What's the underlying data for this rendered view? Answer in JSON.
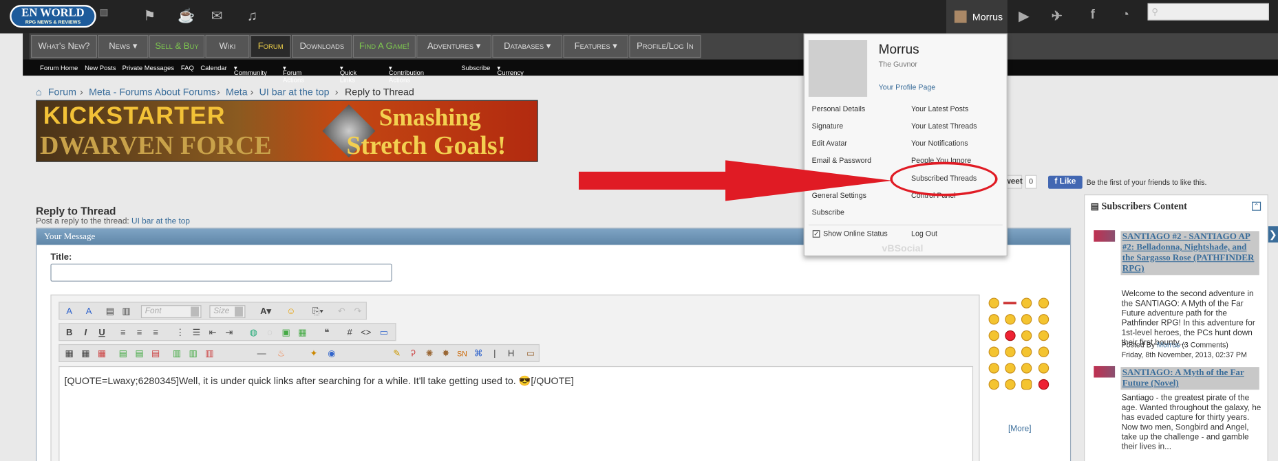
{
  "topbar": {
    "logo": "EN WORLD",
    "logo_tag": "RPG NEWS & REVIEWS",
    "icons": [
      "flag-icon",
      "cup-icon",
      "chat-icon",
      "bell-icon"
    ],
    "user": "Morrus",
    "social_icons": [
      "youtube-icon",
      "twitter-icon",
      "facebook-icon",
      "rss-icon"
    ],
    "search_placeholder": ""
  },
  "nav": {
    "items": [
      "What's New?",
      "News",
      "Sell & Buy",
      "Wiki",
      "Forum",
      "Downloads",
      "Find A Game!",
      "Adventures",
      "Databases",
      "Features",
      "Profile/Log In"
    ]
  },
  "subnav": {
    "items": [
      "Forum Home",
      "New Posts",
      "Private Messages",
      "FAQ",
      "Calendar",
      "Community",
      "Forum Actions",
      "Quick Links",
      "Contribution Actions",
      "Subscribe",
      "Currency"
    ]
  },
  "breadcrumb": {
    "items": [
      "Forum",
      "Meta - Forums About Forums",
      "Meta",
      "UI bar at the top"
    ],
    "current": "Reply to Thread"
  },
  "banner": {
    "line1": "KICKSTARTER",
    "line2": "DWARVEN FORCE",
    "line3": "Smashing",
    "line4": "Stretch Goals!"
  },
  "social_bar": {
    "tweet": "Tweet",
    "tweet_count": "0",
    "like": "Like",
    "like_text": "Be the first of your friends to like this."
  },
  "reply": {
    "title": "Reply to Thread",
    "sub_prefix": "Post a reply to the thread:",
    "sub_link": "UI bar at the top",
    "panel_title": "Your Message",
    "title_label": "Title:",
    "font_placeholder": "Font",
    "size_placeholder": "Size",
    "message": "[QUOTE=Lwaxy;6280345]Well, it is under quick links after searching for a while. It'll take getting used to. 😎[/QUOTE]",
    "more": "[More]"
  },
  "sidebar": {
    "title": "Subscribers Content",
    "items": [
      {
        "title": "SANTIAGO #2 - SANTIAGO AP #2: Belladonna, Nightshade, and the Sargasso Rose (PATHFINDER RPG)",
        "body": "Welcome to the second adventure in the SANTIAGO: A Myth of the Far Future adventure path for the Pathfinder RPG! In this adventure for 1st-level heroes, the PCs hunt down their first bounty,...",
        "posted_by_label": "Posted By",
        "posted_by": "Morrus",
        "comments": "(3 Comments)",
        "date": "Friday, 8th November, 2013, 02:37 PM"
      },
      {
        "title": "SANTIAGO: A Myth of the Far Future (Novel)",
        "body": "Santiago - the greatest pirate of the age. Wanted throughout the galaxy, he has evaded capture for thirty years. Now two men, Songbird and Angel, take up the challenge - and gamble their lives in..."
      }
    ]
  },
  "dropdown": {
    "name": "Morrus",
    "tagline": "The Guvnor",
    "profile_link": "Your Profile Page",
    "left_links": [
      "Personal Details",
      "Signature",
      "Edit Avatar",
      "Email & Password",
      "",
      "General Settings",
      "Subscribe"
    ],
    "right_links": [
      "Your Latest Posts",
      "Your Latest Threads",
      "Your Notifications",
      "People You Ignore",
      "Subscribed Threads",
      "Control Panel"
    ],
    "online_status": "Show Online Status",
    "logout": "Log Out",
    "footer": "vBSocial"
  },
  "colors": {
    "accent": "#3a6d9a",
    "annotation_red": "#e01b24",
    "nav_active": "#f0d24a",
    "nav_green": "#7ec850"
  }
}
